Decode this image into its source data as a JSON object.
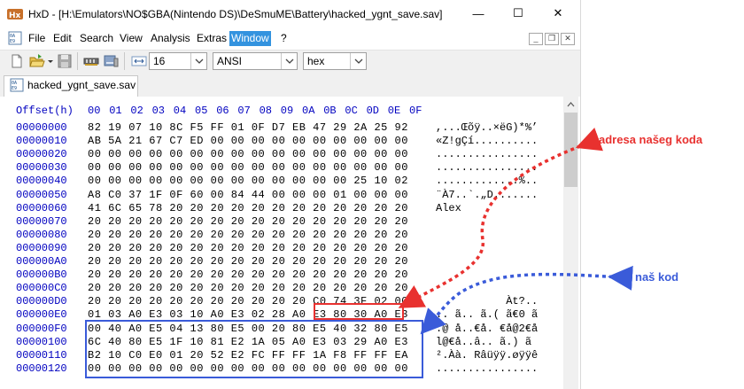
{
  "window": {
    "app_name": "HxD",
    "title": "HxD - [H:\\Emulators\\NO$GBA(Nintendo DS)\\DeSmuME\\Battery\\hacked_ygnt_save.sav]",
    "minimize_glyph": "—",
    "maximize_glyph": "☐",
    "close_glyph": "✕"
  },
  "menu": {
    "items": [
      "File",
      "Edit",
      "Search",
      "View",
      "Analysis",
      "Extras",
      "Window",
      "?"
    ],
    "active": "Window"
  },
  "toolbar": {
    "bytes_per_row": "16",
    "charset": "ANSI",
    "display_mode": "hex"
  },
  "tab": {
    "label": "hacked_ygnt_save.sav"
  },
  "editor": {
    "offset_header": "Offset(h)",
    "column_headers": [
      "00",
      "01",
      "02",
      "03",
      "04",
      "05",
      "06",
      "07",
      "08",
      "09",
      "0A",
      "0B",
      "0C",
      "0D",
      "0E",
      "0F"
    ],
    "rows": [
      {
        "offset": "00000000",
        "hex": "82 19 07 10 8C F5 FF 01 0F D7 EB 47 29 2A 25 92",
        "ascii": ",...Œõÿ..×ëG)*%’"
      },
      {
        "offset": "00000010",
        "hex": "AB 5A 21 67 C7 ED 00 00 00 00 00 00 00 00 00 00",
        "ascii": "«Z!gÇí.........."
      },
      {
        "offset": "00000020",
        "hex": "00 00 00 00 00 00 00 00 00 00 00 00 00 00 00 00",
        "ascii": "................"
      },
      {
        "offset": "00000030",
        "hex": "00 00 00 00 00 00 00 00 00 00 00 00 00 00 00 00",
        "ascii": "................"
      },
      {
        "offset": "00000040",
        "hex": "00 00 00 00 00 00 00 00 00 00 00 00 00 25 10 02",
        "ascii": ".............%.."
      },
      {
        "offset": "00000050",
        "hex": "A8 C0 37 1F 0F 60 00 84 44 00 00 00 01 00 00 00",
        "ascii": "¨À7..`.„D......."
      },
      {
        "offset": "00000060",
        "hex": "41 6C 65 78 20 20 20 20 20 20 20 20 20 20 20 20",
        "ascii": "Alex            "
      },
      {
        "offset": "00000070",
        "hex": "20 20 20 20 20 20 20 20 20 20 20 20 20 20 20 20",
        "ascii": "                "
      },
      {
        "offset": "00000080",
        "hex": "20 20 20 20 20 20 20 20 20 20 20 20 20 20 20 20",
        "ascii": "                "
      },
      {
        "offset": "00000090",
        "hex": "20 20 20 20 20 20 20 20 20 20 20 20 20 20 20 20",
        "ascii": "                "
      },
      {
        "offset": "000000A0",
        "hex": "20 20 20 20 20 20 20 20 20 20 20 20 20 20 20 20",
        "ascii": "                "
      },
      {
        "offset": "000000B0",
        "hex": "20 20 20 20 20 20 20 20 20 20 20 20 20 20 20 20",
        "ascii": "                "
      },
      {
        "offset": "000000C0",
        "hex": "20 20 20 20 20 20 20 20 20 20 20 20 20 20 20 20",
        "ascii": "                "
      },
      {
        "offset": "000000D0",
        "hex": "20 20 20 20 20 20 20 20 20 20 20 C0 74 3F 02 00",
        "ascii": "           Àt?.."
      },
      {
        "offset": "000000E0",
        "hex": "01 03 A0 E3 03 10 A0 E3 02 28 A0 E3 80 30 A0 E3",
        "ascii": ".. ã.. ã.( ã€0 ã"
      },
      {
        "offset": "000000F0",
        "hex": "00 40 A0 E5 04 13 80 E5 00 20 80 E5 40 32 80 E5",
        "ascii": ".@ å..€å. €å@2€å"
      },
      {
        "offset": "00000100",
        "hex": "6C 40 80 E5 1F 10 81 E2 1A 05 A0 E3 03 29 A0 E3",
        "ascii": "l@€å..â.. ã.) ã"
      },
      {
        "offset": "00000110",
        "hex": "B2 10 C0 E0 01 20 52 E2 FC FF FF 1A F8 FF FF EA",
        "ascii": "².Àà. Râüÿÿ.øÿÿê"
      },
      {
        "offset": "00000120",
        "hex": "00 00 00 00 00 00 00 00 00 00 00 00 00 00 00 00",
        "ascii": "................"
      }
    ]
  },
  "annotations": {
    "address_label": "adresa našeg koda",
    "code_label": "naš kod",
    "address_color": "#e8312f",
    "code_color": "#3a5bd9"
  },
  "colors": {
    "offset_blue": "#0000c0",
    "menu_highlight": "#3393df",
    "red_box": "#e8312f",
    "blue_box": "#3a5bd9"
  }
}
